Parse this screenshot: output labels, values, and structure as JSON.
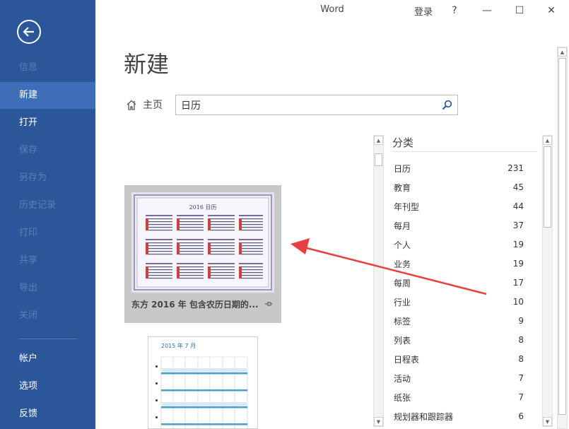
{
  "window": {
    "title": "Word",
    "signin": "登录",
    "help": "?",
    "controls": {
      "minimize": "—",
      "maximize": "☐",
      "close": "✕"
    }
  },
  "sidebar": {
    "items": [
      {
        "label": "信息",
        "state": "disabled"
      },
      {
        "label": "新建",
        "state": "active"
      },
      {
        "label": "打开",
        "state": "normal"
      },
      {
        "label": "保存",
        "state": "disabled"
      },
      {
        "label": "另存为",
        "state": "disabled"
      },
      {
        "label": "历史记录",
        "state": "disabled"
      },
      {
        "label": "打印",
        "state": "disabled"
      },
      {
        "label": "共享",
        "state": "disabled"
      },
      {
        "label": "导出",
        "state": "disabled"
      },
      {
        "label": "关闭",
        "state": "disabled"
      }
    ],
    "bottom_items": [
      {
        "label": "帐户"
      },
      {
        "label": "选项"
      },
      {
        "label": "反馈"
      }
    ]
  },
  "main": {
    "page_title": "新建",
    "home_label": "主页",
    "search_value": "日历",
    "templates": [
      {
        "label": "东方 2016 年  包含农历日期的...",
        "thumb_title": "2016 日历"
      },
      {
        "thumb_title": "2015 年 7 月"
      }
    ]
  },
  "categories": {
    "header": "分类",
    "items": [
      {
        "name": "日历",
        "count": "231"
      },
      {
        "name": "教育",
        "count": "45"
      },
      {
        "name": "年刊型",
        "count": "44"
      },
      {
        "name": "每月",
        "count": "37"
      },
      {
        "name": "个人",
        "count": "19"
      },
      {
        "name": "业务",
        "count": "19"
      },
      {
        "name": "每周",
        "count": "17"
      },
      {
        "name": "行业",
        "count": "10"
      },
      {
        "name": "标签",
        "count": "9"
      },
      {
        "name": "列表",
        "count": "8"
      },
      {
        "name": "日程表",
        "count": "8"
      },
      {
        "name": "活动",
        "count": "7"
      },
      {
        "name": "纸张",
        "count": "7"
      },
      {
        "name": "规划器和跟踪器",
        "count": "6"
      }
    ]
  },
  "colors": {
    "sidebar_bg": "#2b579a",
    "sidebar_active": "#3f6eb8",
    "annotation_arrow": "#e84040"
  }
}
